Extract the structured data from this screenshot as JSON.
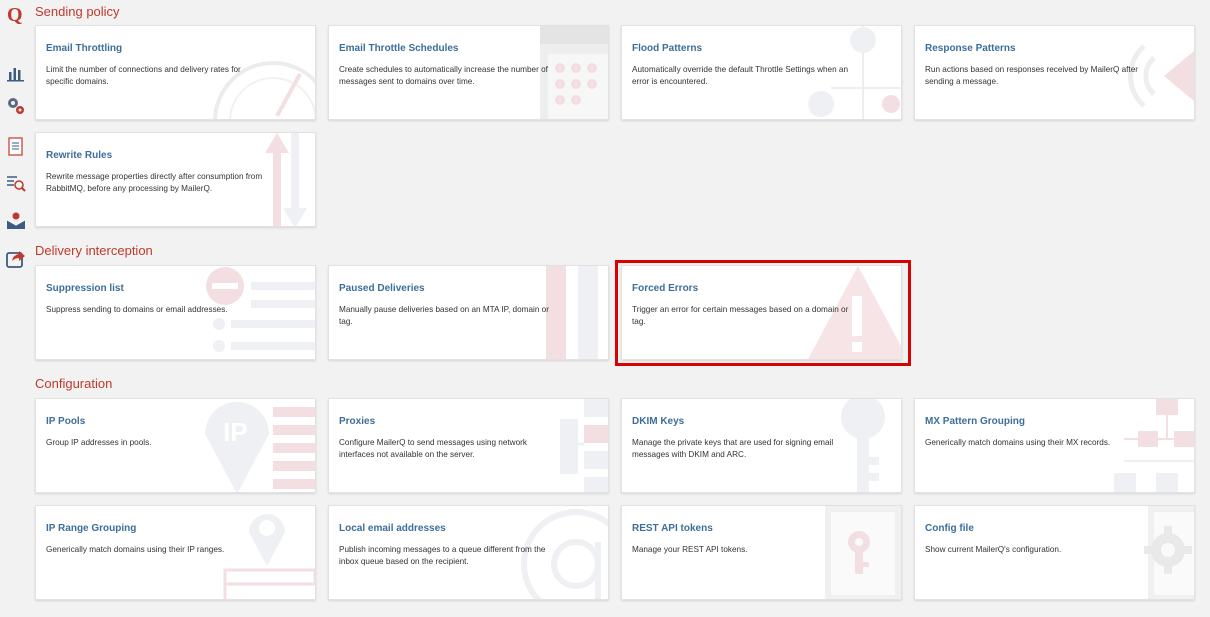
{
  "app": {
    "logo": "Q"
  },
  "sidebar": {
    "items": [
      {
        "name": "stats-icon"
      },
      {
        "name": "settings-icon"
      },
      {
        "name": "document-icon"
      },
      {
        "name": "search-list-icon"
      },
      {
        "name": "mail-icon"
      },
      {
        "name": "share-icon"
      }
    ]
  },
  "sections": {
    "sending_policy": {
      "title": "Sending policy",
      "cards": [
        {
          "title": "Email Throttling",
          "desc": "Limit the number of connections and delivery rates for specific domains."
        },
        {
          "title": "Email Throttle Schedules",
          "desc": "Create schedules to automatically increase the number of messages sent to domains over time."
        },
        {
          "title": "Flood Patterns",
          "desc": "Automatically override the default Throttle Settings when an error is encountered."
        },
        {
          "title": "Response Patterns",
          "desc": "Run actions based on responses received by MailerQ after sending a message."
        },
        {
          "title": "Rewrite Rules",
          "desc": "Rewrite message properties directly after consumption from RabbitMQ, before any processing by MailerQ."
        }
      ]
    },
    "delivery_interception": {
      "title": "Delivery interception",
      "cards": [
        {
          "title": "Suppression list",
          "desc": "Suppress sending to domains or email addresses."
        },
        {
          "title": "Paused Deliveries",
          "desc": "Manually pause deliveries based on an MTA IP, domain or tag."
        },
        {
          "title": "Forced Errors",
          "desc": "Trigger an error for certain messages based on a domain or tag."
        }
      ]
    },
    "configuration": {
      "title": "Configuration",
      "cards": [
        {
          "title": "IP Pools",
          "desc": "Group IP addresses in pools."
        },
        {
          "title": "Proxies",
          "desc": "Configure MailerQ to send messages using network interfaces not available on the server."
        },
        {
          "title": "DKIM Keys",
          "desc": "Manage the private keys that are used for signing email messages with DKIM and ARC."
        },
        {
          "title": "MX Pattern Grouping",
          "desc": "Generically match domains using their MX records."
        },
        {
          "title": "IP Range Grouping",
          "desc": "Generically match domains using their IP ranges."
        },
        {
          "title": "Local email addresses",
          "desc": "Publish incoming messages to a queue different from the inbox queue based on the recipient."
        },
        {
          "title": "REST API tokens",
          "desc": "Manage your REST API tokens."
        },
        {
          "title": "Config file",
          "desc": "Show current MailerQ's configuration."
        }
      ]
    }
  },
  "colors": {
    "accent": "#c0392b",
    "link": "#3d6e99",
    "highlight": "#d90000",
    "decor": "#f3e6e8",
    "decor2": "#e9edf3"
  }
}
